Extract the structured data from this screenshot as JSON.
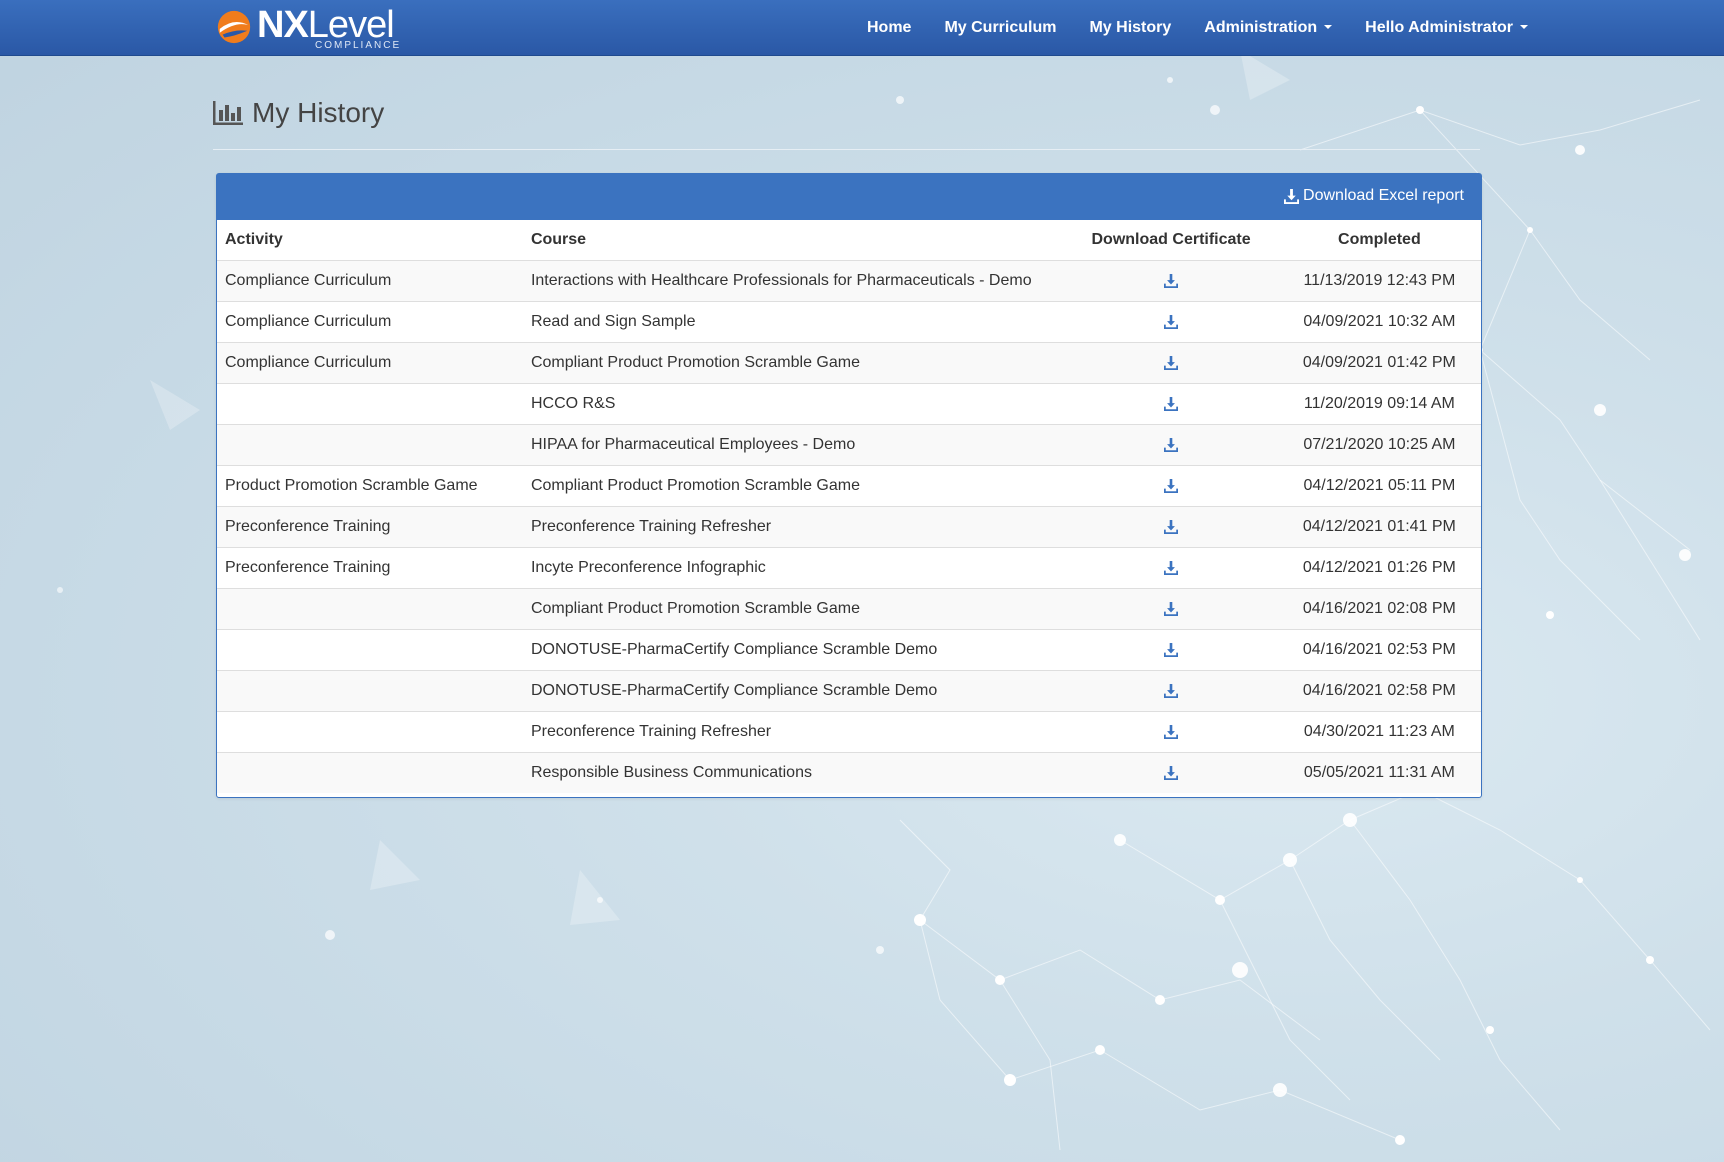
{
  "brand": {
    "name_bold": "NX",
    "name_rest": "Level",
    "subtitle": "COMPLIANCE"
  },
  "nav": {
    "home": "Home",
    "curriculum": "My Curriculum",
    "history": "My History",
    "admin": "Administration",
    "user": "Hello Administrator"
  },
  "page": {
    "title": "My History",
    "title_icon": "bar-chart-icon"
  },
  "panel": {
    "download_excel": "Download Excel report"
  },
  "table": {
    "headers": {
      "activity": "Activity",
      "course": "Course",
      "certificate": "Download Certificate",
      "completed": "Completed"
    },
    "rows": [
      {
        "activity": "Compliance Curriculum",
        "course": "Interactions with Healthcare Professionals for Pharmaceuticals - Demo",
        "completed": "11/13/2019 12:43 PM"
      },
      {
        "activity": "Compliance Curriculum",
        "course": "Read and Sign Sample",
        "completed": "04/09/2021 10:32 AM"
      },
      {
        "activity": "Compliance Curriculum",
        "course": "Compliant Product Promotion Scramble Game",
        "completed": "04/09/2021 01:42 PM"
      },
      {
        "activity": "",
        "course": "HCCO R&S",
        "completed": "11/20/2019 09:14 AM"
      },
      {
        "activity": "",
        "course": "HIPAA for Pharmaceutical Employees - Demo",
        "completed": "07/21/2020 10:25 AM"
      },
      {
        "activity": "Product Promotion Scramble Game",
        "course": "Compliant Product Promotion Scramble Game",
        "completed": "04/12/2021 05:11 PM"
      },
      {
        "activity": "Preconference Training",
        "course": "Preconference Training Refresher",
        "completed": "04/12/2021 01:41 PM"
      },
      {
        "activity": "Preconference Training",
        "course": "Incyte Preconference Infographic",
        "completed": "04/12/2021 01:26 PM"
      },
      {
        "activity": "",
        "course": "Compliant Product Promotion Scramble Game",
        "completed": "04/16/2021 02:08 PM"
      },
      {
        "activity": "",
        "course": "DONOTUSE-PharmaCertify Compliance Scramble Demo",
        "completed": "04/16/2021 02:53 PM"
      },
      {
        "activity": "",
        "course": "DONOTUSE-PharmaCertify Compliance Scramble Demo",
        "completed": "04/16/2021 02:58 PM"
      },
      {
        "activity": "",
        "course": "Preconference Training Refresher",
        "completed": "04/30/2021 11:23 AM"
      },
      {
        "activity": "",
        "course": "Responsible Business Communications",
        "completed": "05/05/2021 11:31 AM"
      }
    ]
  },
  "colors": {
    "nav": "#2f62b2",
    "panel_head": "#3b73c0",
    "accent_icon": "#3b73c0",
    "logo_orange": "#f07c1c"
  }
}
